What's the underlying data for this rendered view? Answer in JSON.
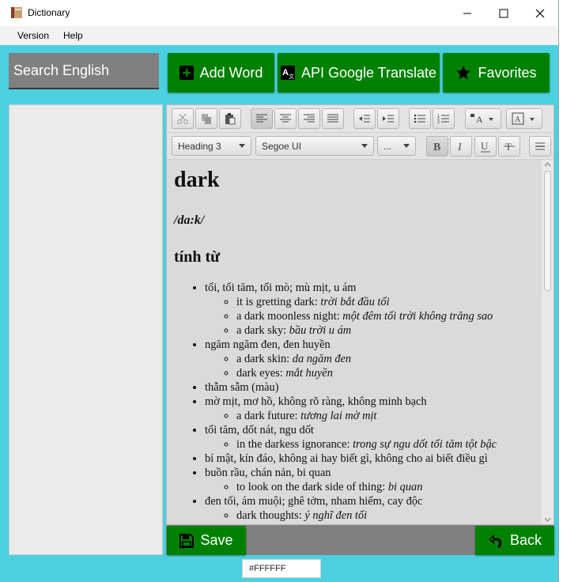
{
  "window": {
    "title": "Dictionary"
  },
  "menu": [
    "Version",
    "Help"
  ],
  "search": {
    "placeholder": "Search English"
  },
  "buttons": {
    "add_word": "Add Word",
    "google_translate": "API Google Translate",
    "favorites": "Favorites",
    "save": "Save",
    "back": "Back"
  },
  "toolbar": {
    "paragraph_style": "Heading 3",
    "font_family": "Segoe UI",
    "font_size": "..."
  },
  "entry": {
    "word": "dark",
    "pronunciation": "/da:k/",
    "part_of_speech": "tính từ",
    "senses": [
      {
        "meaning": "tối, tối tăm, tối mò; mù mịt, u ám",
        "examples": [
          {
            "en": "it is gretting dark: ",
            "vi": "trời bắt đầu tối"
          },
          {
            "en": "a dark moonless night: ",
            "vi": "một đêm tối trời không trăng sao"
          },
          {
            "en": "a dark sky: ",
            "vi": "bầu trời u ám"
          }
        ]
      },
      {
        "meaning": "ngăm ngăm đen, đen huyền",
        "examples": [
          {
            "en": "a dark skin: ",
            "vi": "da ngăm đen"
          },
          {
            "en": "dark eyes: ",
            "vi": "mắt huyền"
          }
        ]
      },
      {
        "meaning": "thẫm sẫm (màu)",
        "examples": []
      },
      {
        "meaning": "mờ mịt, mơ hồ, không rõ ràng, không minh bạch",
        "examples": [
          {
            "en": "a dark future: ",
            "vi": "tương lai mờ mịt"
          }
        ]
      },
      {
        "meaning": "tối tăm, dốt nát, ngu dốt",
        "examples": [
          {
            "en": "in the darkess ignorance: ",
            "vi": "trong sự ngu dốt tối tăm tột bậc"
          }
        ]
      },
      {
        "meaning": "bí mật, kín đáo, không ai hay biết gì, không cho ai biết điều gì",
        "examples": []
      },
      {
        "meaning": "buồn rầu, chán nản, bi quan",
        "examples": [
          {
            "en": "to look on the dark side of thing: ",
            "vi": "bi quan"
          }
        ]
      },
      {
        "meaning": "đen tối, ám muội; ghê tởm, nham hiểm, cay độc",
        "examples": [
          {
            "en": "dark thoughts: ",
            "vi": "ý nghĩ đen tối"
          }
        ]
      }
    ]
  },
  "color_picker": {
    "value": "#FFFFFF"
  },
  "colors": {
    "background": "#4cd0e0",
    "button_green": "#008000",
    "panel_gray": "#808080"
  }
}
